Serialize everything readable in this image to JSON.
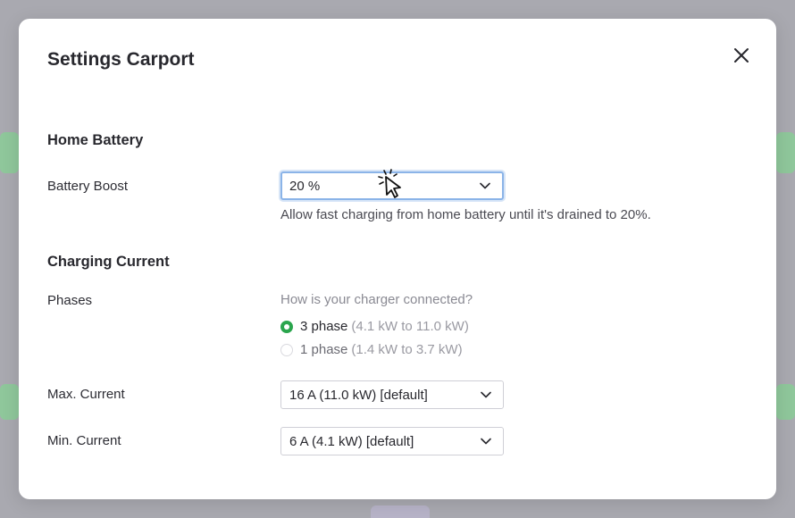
{
  "modal": {
    "title": "Settings Carport",
    "close_icon": "close-icon"
  },
  "home_battery": {
    "section_title": "Home Battery",
    "battery_boost": {
      "label": "Battery Boost",
      "value": "20 %",
      "help_text": "Allow fast charging from home battery until it's drained to 20%."
    }
  },
  "charging_current": {
    "section_title": "Charging Current",
    "phases": {
      "label": "Phases",
      "question": "How is your charger connected?",
      "options": [
        {
          "label": "3 phase",
          "detail": "(4.1 kW to 11.0 kW)",
          "checked": true
        },
        {
          "label": "1 phase",
          "detail": "(1.4 kW to 3.7 kW)",
          "checked": false
        }
      ]
    },
    "max_current": {
      "label": "Max. Current",
      "value": "16 A (11.0 kW) [default]"
    },
    "min_current": {
      "label": "Min. Current",
      "value": "6 A (4.1 kW) [default]"
    }
  },
  "colors": {
    "accent_green": "#2aa54d",
    "focus_ring": "#8bb4e8"
  }
}
